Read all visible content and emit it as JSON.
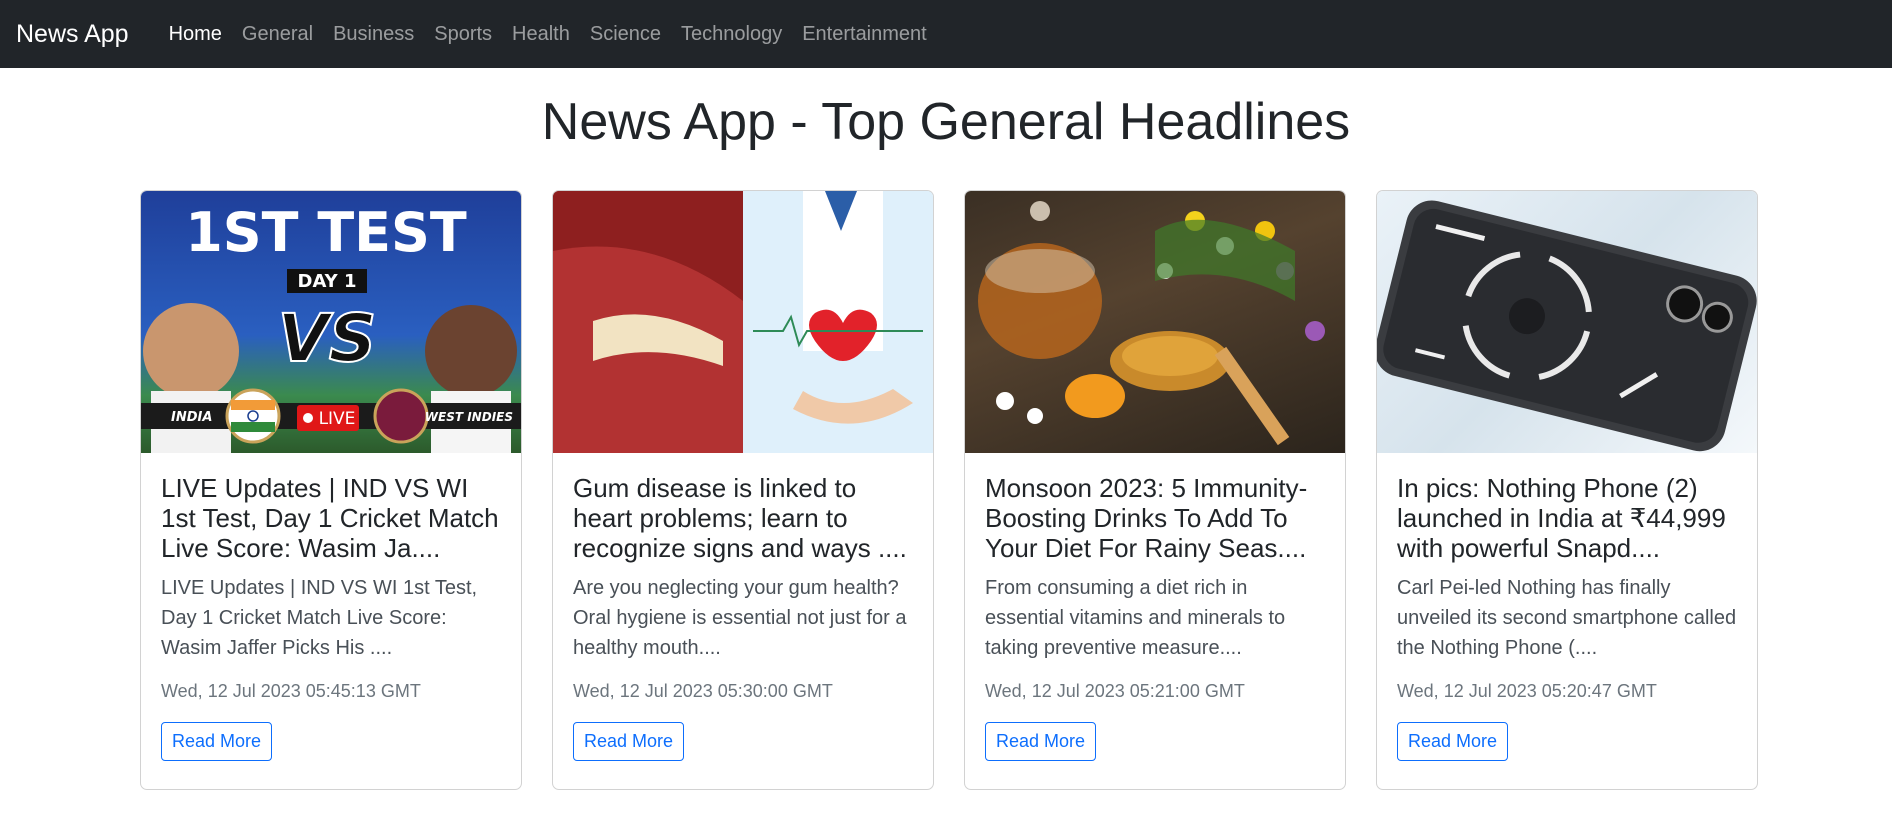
{
  "nav": {
    "brand": "News App",
    "items": [
      "Home",
      "General",
      "Business",
      "Sports",
      "Health",
      "Science",
      "Technology",
      "Entertainment"
    ]
  },
  "page": {
    "title": "News App - Top General Headlines"
  },
  "cards": [
    {
      "title": "LIVE Updates | IND VS WI 1st Test, Day 1 Cricket Match Live Score: Wasim Ja....",
      "description": "LIVE Updates | IND VS WI 1st Test, Day 1 Cricket Match Live Score: Wasim Jaffer Picks His ....",
      "date": "Wed, 12 Jul 2023 05:45:13 GMT",
      "button": "Read More",
      "image_text": {
        "headline": "1ST TEST",
        "day": "DAY 1",
        "vs": "VS",
        "left": "INDIA",
        "live": "LIVE",
        "right": "WEST INDIES"
      }
    },
    {
      "title": "Gum disease is linked to heart problems; learn to recognize signs and ways ....",
      "description": "Are you neglecting your gum health? Oral hygiene is essential not just for a healthy mouth....",
      "date": "Wed, 12 Jul 2023 05:30:00 GMT",
      "button": "Read More"
    },
    {
      "title": "Monsoon 2023: 5 Immunity-Boosting Drinks To Add To Your Diet For Rainy Seas....",
      "description": "From consuming a diet rich in essential vitamins and minerals to taking preventive measure....",
      "date": "Wed, 12 Jul 2023 05:21:00 GMT",
      "button": "Read More"
    },
    {
      "title": "In pics: Nothing Phone (2) launched in India at ₹44,999 with powerful Snapd....",
      "description": "Carl Pei-led Nothing has finally unveiled its second smartphone called the Nothing Phone (....",
      "date": "Wed, 12 Jul 2023 05:20:47 GMT",
      "button": "Read More"
    }
  ],
  "colors": {
    "navbar": "#212529",
    "link": "#0d6efd",
    "text": "#212529"
  }
}
